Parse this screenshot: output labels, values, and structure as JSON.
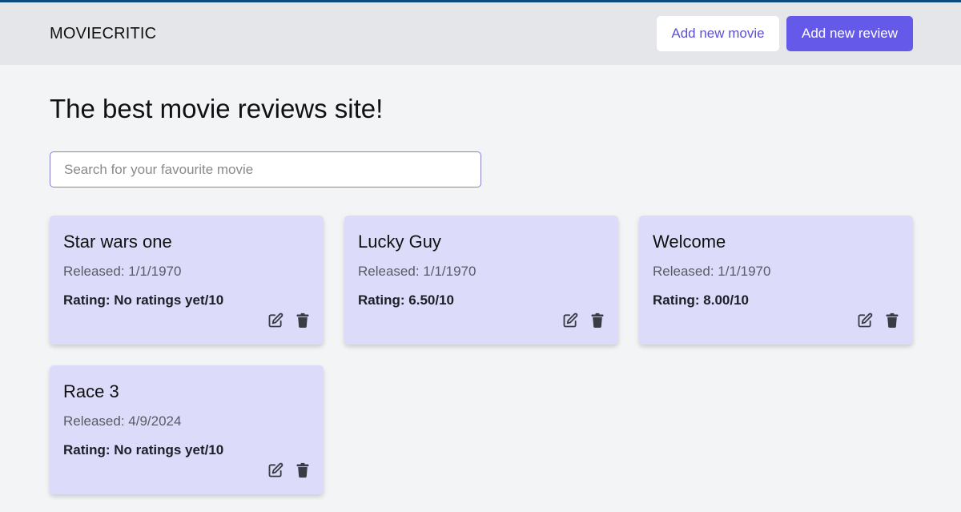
{
  "header": {
    "brand": "MOVIECRITIC",
    "add_movie_label": "Add new movie",
    "add_review_label": "Add new review"
  },
  "main": {
    "title": "The best movie reviews site!",
    "search": {
      "placeholder": "Search for your favourite movie",
      "value": ""
    }
  },
  "movies": [
    {
      "title": "Star wars one",
      "released": "Released: 1/1/1970",
      "rating": "Rating: No ratings yet/10"
    },
    {
      "title": "Lucky Guy",
      "released": "Released: 1/1/1970",
      "rating": "Rating: 6.50/10"
    },
    {
      "title": "Welcome",
      "released": "Released: 1/1/1970",
      "rating": "Rating: 8.00/10"
    },
    {
      "title": "Race 3",
      "released": "Released: 4/9/2024",
      "rating": "Rating: No ratings yet/10"
    }
  ],
  "icons": {
    "edit": "edit-icon",
    "delete": "trash-icon"
  },
  "colors": {
    "accent": "#6559ea",
    "card_bg": "#dcdcfa",
    "header_bg": "#e4e6e9",
    "page_bg": "#f2f4f6"
  }
}
